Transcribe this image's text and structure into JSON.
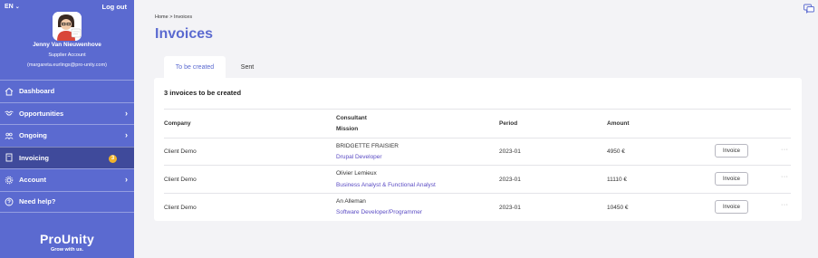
{
  "sidebar": {
    "language": "EN",
    "logout_label": "Log out",
    "user_name": "Jenny Van Nieuwenhove",
    "user_role": "Supplier Account",
    "user_email": "(margareta.eurlings@pro-unity.com)",
    "items": [
      {
        "label": "Dashboard",
        "icon": "home-icon"
      },
      {
        "label": "Opportunities",
        "icon": "handshake-icon"
      },
      {
        "label": "Ongoing",
        "icon": "people-icon"
      },
      {
        "label": "Invoicing",
        "icon": "document-icon",
        "badge": "3"
      },
      {
        "label": "Account",
        "icon": "gear-icon"
      },
      {
        "label": "Need help?",
        "icon": "help-icon"
      }
    ],
    "brand": "ProUnity",
    "tagline": "Grow with us."
  },
  "breadcrumb": "Home > Invoices",
  "page_title": "Invoices",
  "tabs": [
    {
      "label": "To be created",
      "active": true
    },
    {
      "label": "Sent",
      "active": false
    }
  ],
  "card": {
    "title": "3 invoices to be created",
    "headers": {
      "company": "Company",
      "consultant": "Consultant",
      "mission": "Mission",
      "period": "Period",
      "amount": "Amount"
    },
    "rows": [
      {
        "company": "Client Demo",
        "consultant": "BRIDGETTE FRAISIER",
        "mission": "Drupal Developer",
        "period": "2023-01",
        "amount": "4950 €",
        "action": "Invoice",
        "more": "···"
      },
      {
        "company": "Client Demo",
        "consultant": "Olivier Lemieux",
        "mission": "Business Analyst & Functional Analyst",
        "period": "2023-01",
        "amount": "11110 €",
        "action": "Invoice",
        "more": "···"
      },
      {
        "company": "Client Demo",
        "consultant": "An Alleman",
        "mission": "Software Developer/Programmer",
        "period": "2023-01",
        "amount": "10450 €",
        "action": "Invoice",
        "more": "···"
      }
    ]
  },
  "colors": {
    "sidebar": "#5b6ad0",
    "sidebar_active": "#3f4a9b",
    "accent": "#5b6ad0",
    "badge": "#f0b32a",
    "link": "#5b4cc4"
  }
}
